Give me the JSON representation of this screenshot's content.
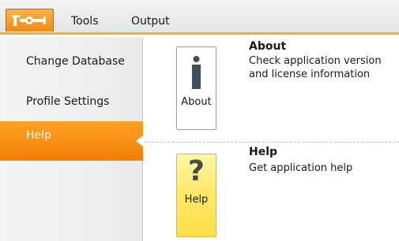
{
  "menubar": {
    "app_button_icon": "wrench-logo-icon",
    "tabs": [
      "Tools",
      "Output"
    ]
  },
  "sidebar": {
    "items": [
      {
        "label": "Change Database"
      },
      {
        "label": "Profile Settings"
      },
      {
        "label": "Help",
        "selected": true
      }
    ]
  },
  "content": {
    "about": {
      "tile_label": "About",
      "icon": "info-icon",
      "title": "About",
      "description": "Check application version and license information"
    },
    "help": {
      "tile_label": "Help",
      "icon": "question-mark-icon",
      "icon_glyph": "?",
      "title": "Help",
      "description": "Get application help"
    }
  },
  "colors": {
    "accent": "#f7b11c",
    "selected": "#f58d12",
    "help_tile": "#ffe86a"
  }
}
